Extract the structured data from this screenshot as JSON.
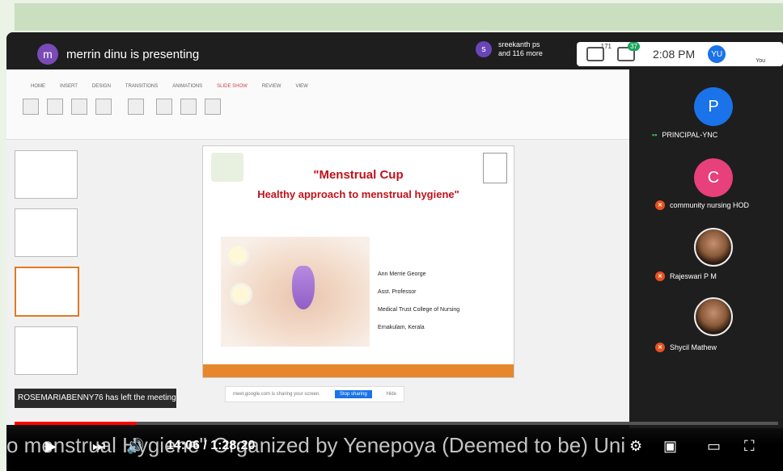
{
  "meeting": {
    "presenter_initial": "m",
    "presenter_text": "merrin dinu is presenting",
    "attendee_initial": "s",
    "attendee_line1": "sreekanth ps",
    "attendee_line2": "and 116 more",
    "people_count": "171",
    "chat_badge": "37",
    "clock": "2:08 PM",
    "user_initials": "YU",
    "you_label": "You"
  },
  "slide": {
    "title_line1": "\"Menstrual Cup",
    "title_line2": "Healthy approach to menstrual hygiene\"",
    "author": "Ann Merrie George",
    "role": "Asst. Professor",
    "college": "Medical Trust College of Nursing",
    "place": "Ernakulam, Kerala"
  },
  "share_bar": {
    "text": "meet.google.com is sharing your screen.",
    "stop_label": "Stop sharing",
    "hide_label": "Hide"
  },
  "notice": "ROSEMARIABENNY76 has left the meeting",
  "participants": [
    {
      "initial": "P",
      "name": "PRINCIPAL-YNC",
      "color": "#1a73e8"
    },
    {
      "initial": "C",
      "name": "community nursing HOD",
      "color": "#e8407a"
    },
    {
      "initial": "",
      "name": "Rajeswari P M"
    },
    {
      "initial": "",
      "name": "Shycil Mathew"
    }
  ],
  "player": {
    "time_current": "14:06",
    "time_total": "1:28:20",
    "caption": "o menstrual Hygiene\" Organized by Yenepoya (Deemed to be) Uni",
    "progress_fraction": 0.16
  },
  "icons": [
    "play-icon",
    "next-icon",
    "volume-icon",
    "settings-icon",
    "miniplayer-icon",
    "theater-icon",
    "fullscreen-icon"
  ]
}
